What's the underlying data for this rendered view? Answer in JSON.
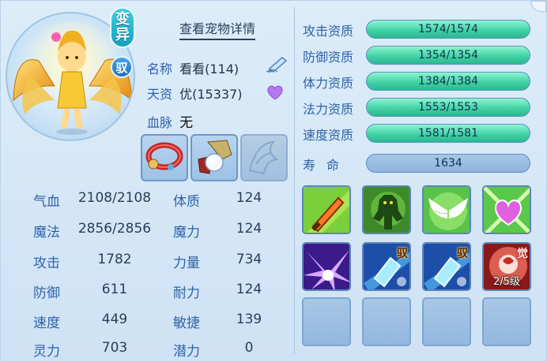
{
  "badges": {
    "mutant": [
      "变",
      "异"
    ],
    "tame": "驭"
  },
  "detail_link": "查看宠物详情",
  "info": {
    "name_label": "名称",
    "name_value": "看看(114)",
    "aptitude_label": "天资",
    "aptitude_value": "优(15337)",
    "bloodline_label": "血脉",
    "bloodline_value": "无"
  },
  "stats_left": [
    {
      "label": "气血",
      "value": "2108/2108"
    },
    {
      "label": "魔法",
      "value": "2856/2856"
    },
    {
      "label": "攻击",
      "value": "1782"
    },
    {
      "label": "防御",
      "value": "611"
    },
    {
      "label": "速度",
      "value": "449"
    },
    {
      "label": "灵力",
      "value": "703"
    }
  ],
  "stats_right": [
    {
      "label": "体质",
      "value": "124"
    },
    {
      "label": "魔力",
      "value": "124"
    },
    {
      "label": "力量",
      "value": "734"
    },
    {
      "label": "耐力",
      "value": "124"
    },
    {
      "label": "敏捷",
      "value": "139"
    },
    {
      "label": "潜力",
      "value": "0"
    }
  ],
  "aptitudes": [
    {
      "label": "攻击资质",
      "value": "1574/1574",
      "fill": 1.0
    },
    {
      "label": "防御资质",
      "value": "1354/1354",
      "fill": 1.0
    },
    {
      "label": "体力资质",
      "value": "1384/1384",
      "fill": 1.0
    },
    {
      "label": "法力资质",
      "value": "1553/1553",
      "fill": 1.0
    },
    {
      "label": "速度资质",
      "value": "1581/1581",
      "fill": 1.0
    }
  ],
  "lifespan": {
    "label": "寿命",
    "value": "1634"
  },
  "skills": [
    {
      "icon": "sword-skill-icon",
      "tag": ""
    },
    {
      "icon": "green-giant-skill-icon",
      "tag": ""
    },
    {
      "icon": "angel-wings-skill-icon",
      "tag": ""
    },
    {
      "icon": "heart-burst-skill-icon",
      "tag": ""
    },
    {
      "icon": "purple-burst-skill-icon",
      "tag": ""
    },
    {
      "icon": "blue-shard-skill-icon",
      "tag": "驭"
    },
    {
      "icon": "blue-shard-skill-icon",
      "tag": "驭"
    },
    {
      "icon": "red-awaken-skill-icon",
      "tag": "觉",
      "level": "2/5级"
    }
  ],
  "colors": {
    "accent_blue": "#2f63a8",
    "bar_green": "#43d2a6",
    "panel_bg": "#d3e6f6"
  }
}
